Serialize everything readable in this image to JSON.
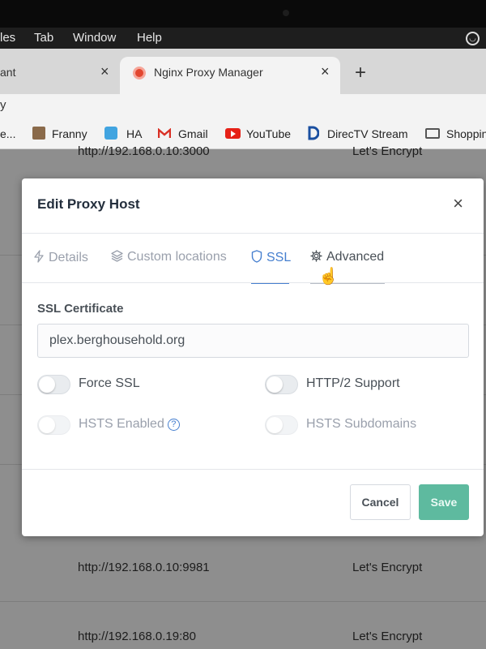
{
  "menubar": {
    "items": [
      "les",
      "Tab",
      "Window",
      "Help"
    ]
  },
  "browser": {
    "tabs": [
      {
        "label": "ant",
        "close": "×"
      },
      {
        "label": "Nginx Proxy Manager",
        "close": "×"
      }
    ],
    "new_tab": "+",
    "address_fragment": "y",
    "bookmarks": [
      "e...",
      "Franny",
      "HA",
      "Gmail",
      "YouTube",
      "DirecTV Stream",
      "Shoppin"
    ]
  },
  "background_rows": [
    {
      "url": "http://192.168.0.10:3000",
      "cert": "Let's Encrypt"
    },
    {
      "url": "http://192.168.0.10:9981",
      "cert": "Let's Encrypt"
    },
    {
      "url": "http://192.168.0.19:80",
      "cert": "Let's Encrypt"
    }
  ],
  "modal": {
    "title": "Edit Proxy Host",
    "close": "×",
    "tabs": {
      "details": "Details",
      "custom_locations": "Custom locations",
      "ssl": "SSL",
      "advanced": "Advanced"
    },
    "active_tab": "SSL",
    "ssl_certificate_label": "SSL Certificate",
    "ssl_certificate_value": "plex.berghousehold.org",
    "toggles": {
      "force_ssl": {
        "label": "Force SSL",
        "on": false,
        "disabled": false
      },
      "http2": {
        "label": "HTTP/2 Support",
        "on": false,
        "disabled": false
      },
      "hsts": {
        "label": "HSTS Enabled",
        "on": false,
        "disabled": true
      },
      "hsts_subdomains": {
        "label": "HSTS Subdomains",
        "on": false,
        "disabled": true
      }
    },
    "help_glyph": "?",
    "buttons": {
      "cancel": "Cancel",
      "save": "Save"
    }
  },
  "colors": {
    "accent": "#467fcf",
    "save": "#5eba9f",
    "overlay": "#8e8e8e"
  }
}
